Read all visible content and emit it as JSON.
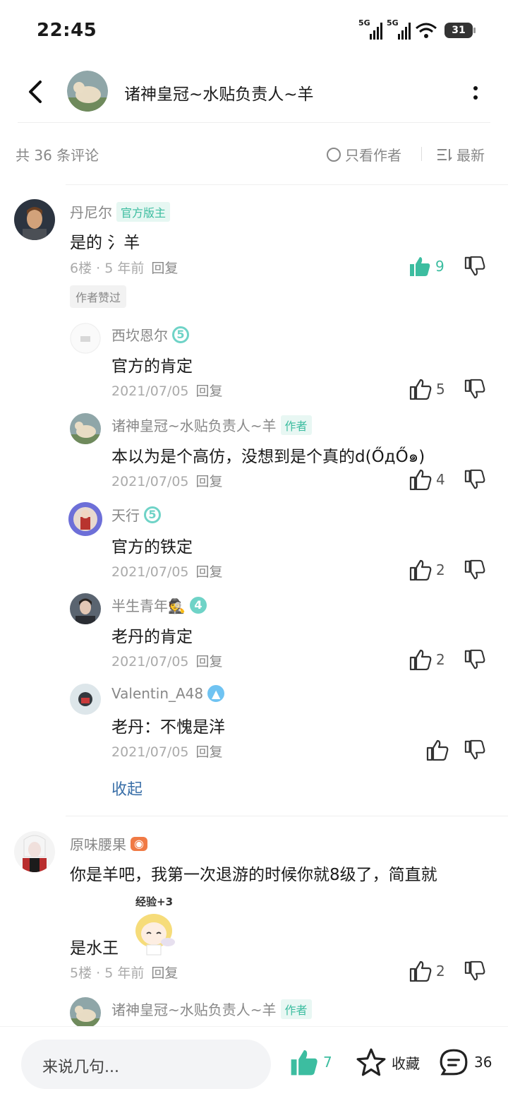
{
  "status": {
    "time": "22:45",
    "network1": "5G",
    "network2": "5G",
    "battery": "31"
  },
  "header": {
    "title": "诸神皇冠~水贴负责人~羊"
  },
  "filter": {
    "count_label": "共 36 条评论",
    "only_author": "只看作者",
    "sort": "最新"
  },
  "comments": [
    {
      "user": "丹尼尔",
      "badge": "官方版主",
      "text": "是的 氵羊",
      "floor": "6楼 · 5 年前",
      "reply": "回复",
      "likes": "9",
      "author_liked": "作者赞过",
      "replies": [
        {
          "user": "西坎恩尔",
          "level": "5",
          "text": "官方的肯定",
          "date": "2021/07/05",
          "reply": "回复",
          "likes": "5"
        },
        {
          "user": "诸神皇冠~水贴负责人~羊",
          "badge": "作者",
          "text": "本以为是个高仿，没想到是个真的d(ŐдŐ๑)",
          "date": "2021/07/05",
          "reply": "回复",
          "likes": "4"
        },
        {
          "user": "天行",
          "level": "5",
          "text": "官方的铁定",
          "date": "2021/07/05",
          "reply": "回复",
          "likes": "2"
        },
        {
          "user": "半生青年🕵",
          "level": "4",
          "text": "老丹的肯定",
          "date": "2021/07/05",
          "reply": "回复",
          "likes": "2"
        },
        {
          "user": "Valentin_A48",
          "text": "老丹：不愧是洋",
          "date": "2021/07/05",
          "reply": "回复",
          "likes": ""
        }
      ],
      "collapse": "收起"
    },
    {
      "user": "原味腰果",
      "text_line1": "你是羊吧，我第一次退游的时候你就8级了，简直就",
      "text_line2": "是水王",
      "sticker_caption": "经验+3",
      "floor": "5楼 · 5 年前",
      "reply": "回复",
      "likes": "2",
      "next_reply": {
        "user": "诸神皇冠~水贴负责人~羊",
        "badge": "作者"
      }
    }
  ],
  "bottom": {
    "placeholder": "来说几句...",
    "likes": "7",
    "favorite": "收藏",
    "comments": "36"
  },
  "colors": {
    "accent": "#3cbda0",
    "link": "#3a6fa8",
    "muted": "#888888"
  }
}
